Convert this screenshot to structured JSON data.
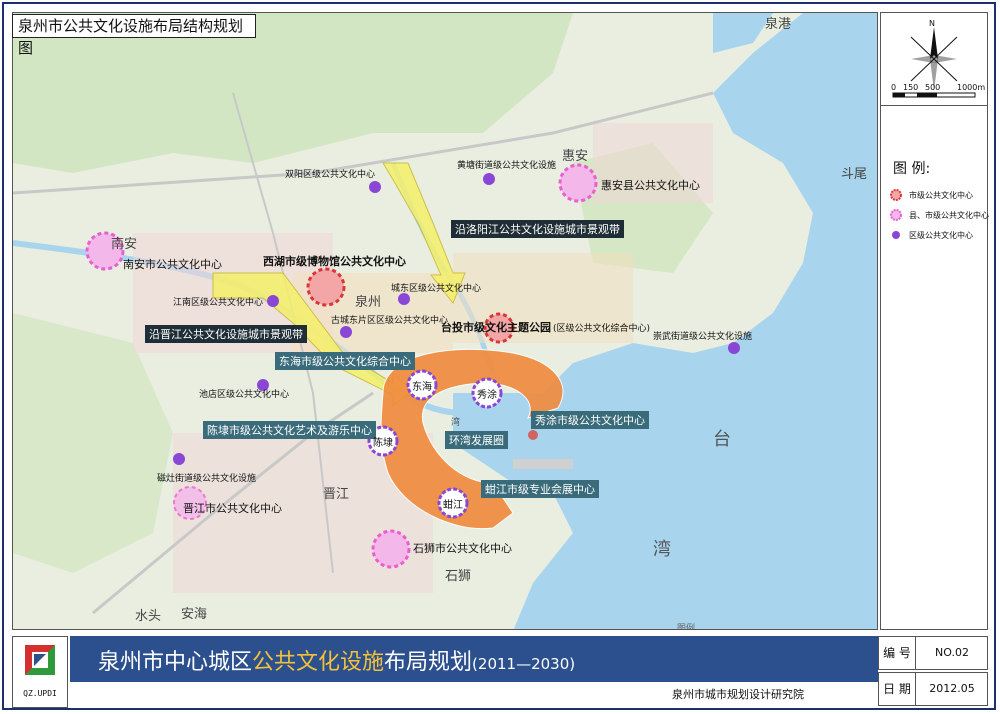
{
  "map_title": "泉州市公共文化设施布局结构规划图",
  "banner": {
    "title_part1": "泉州市中心城区",
    "title_highlight": "公共文化设施",
    "title_part2": "布局规划",
    "years": "(2011—2030)"
  },
  "institute": "泉州市城市规划设计研究院",
  "info": {
    "number_label": "编 号",
    "number_value": "NO.02",
    "date_label": "日 期",
    "date_value": "2012.05"
  },
  "logo_code": "QZ.UPDI",
  "compass": {
    "north": "N",
    "scale_labels": [
      "0",
      "150",
      "500",
      "1000m"
    ]
  },
  "legend": {
    "title": "图  例:",
    "items": [
      {
        "symbol": "city-center",
        "label": "市级公共文化中心"
      },
      {
        "symbol": "county-center",
        "label": "县、市级公共文化中心"
      },
      {
        "symbol": "district-center",
        "label": "区级公共文化中心"
      }
    ]
  },
  "place_names": {
    "quangang": "泉港",
    "huian": "惠安",
    "douwei": "斗尾",
    "nanan": "南安",
    "quanzhou": "泉州",
    "jinjiang": "晋江",
    "shishi": "石狮",
    "shuitou": "水头",
    "anhai": "安海",
    "tai": "台",
    "wan": "湾",
    "wan_small": "湾",
    "legend_faint": "图例"
  },
  "district_centers": {
    "shuangyang": "双阳区级公共文化中心",
    "huangtang": "黄塘街道级公共文化设施",
    "chengdong": "城东区级公共文化中心",
    "gucheng": "古城东片区区级公共文化中心",
    "jiangnan": "江南区级公共文化中心",
    "chidian": "池店区级公共文化中心",
    "cizao": "磁灶街道级公共文化设施",
    "chongwu": "崇武街道级公共文化设施"
  },
  "county_centers": {
    "nanan": "南安市公共文化中心",
    "huian": "惠安县公共文化中心",
    "jinjiang": "晋江市公共文化中心",
    "shishi": "石狮市公共文化中心"
  },
  "city_centers": {
    "xihu": "西湖市级博物馆公共文化中心",
    "taitou": "台投市级文化主题公园",
    "taitou_note": "(区级公共文化综合中心)"
  },
  "corridors": {
    "luoyang": "沿洛阳江公共文化设施城市景观带",
    "jinjiang": "沿晋江公共文化设施城市景观带"
  },
  "ring": {
    "donghai_center": "东海市级公共文化综合中心",
    "xiutu_center": "秀涂市级公共文化中心",
    "chendai_center": "陈埭市级公共文化艺术及游乐中心",
    "ring_name": "环湾发展圈",
    "haijiang_center": "蚶江市级专业会展中心",
    "nodes": {
      "donghai": "东海",
      "xiutu": "秀涂",
      "chendai": "陈埭",
      "haijiang": "蚶江"
    }
  },
  "colors": {
    "banner": "#2c4f8e",
    "highlight": "#f3c23a",
    "sea": "#a9d4ee",
    "land": "#e9eee0",
    "ring_orange": "#f08a3c",
    "corridor_yellow": "#f5f06a",
    "city_center_red": "#d9363b",
    "county_pink": "#e85fd0",
    "district_purple": "#8a47d6"
  }
}
